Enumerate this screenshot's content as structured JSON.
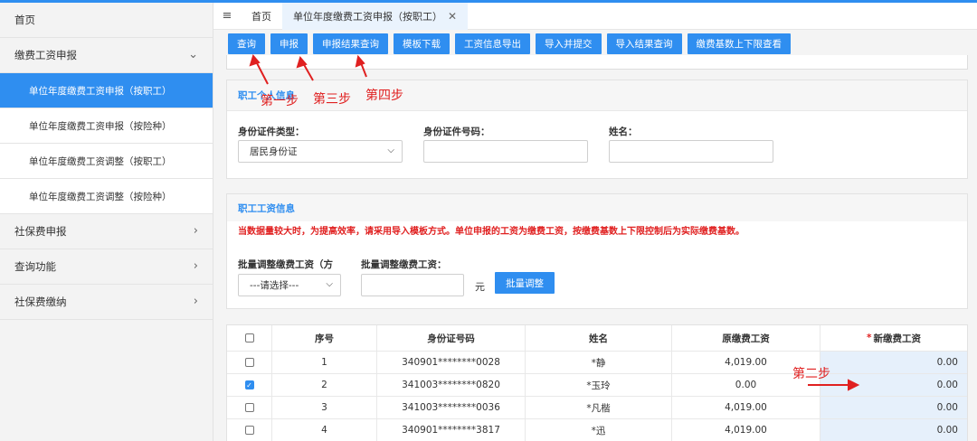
{
  "sidebar": {
    "home": "首页",
    "group1": "缴费工资申报",
    "sub_items": [
      "单位年度缴费工资申报（按职工）",
      "单位年度缴费工资申报（按险种）",
      "单位年度缴费工资调整（按职工）",
      "单位年度缴费工资调整（按险种）"
    ],
    "groups": [
      "社保费申报",
      "查询功能",
      "社保费缴纳"
    ]
  },
  "tabs": {
    "home": "首页",
    "active": "单位年度缴费工资申报（按职工）"
  },
  "toolbar": [
    "查询",
    "申报",
    "申报结果查询",
    "模板下载",
    "工资信息导出",
    "导入并提交",
    "导入结果查询",
    "缴费基数上下限查看"
  ],
  "personal": {
    "title": "职工个人信息",
    "id_type_label": "身份证件类型：",
    "id_type_value": "居民身份证",
    "id_no_label": "身份证件号码：",
    "name_label": "姓名："
  },
  "wage": {
    "title": "职工工资信息",
    "warning": "当数据量较大时，为提高效率，请采用导入模板方式。单位申报的工资为缴费工资，按缴费基数上下限控制后为实际缴费基数。",
    "batch_mode_label": "批量调整缴费工资（方",
    "batch_mode_value": "---请选择---",
    "batch_value_label": "批量调整缴费工资：",
    "unit": "元",
    "batch_button": "批量调整"
  },
  "table": {
    "headers": [
      "序号",
      "身份证号码",
      "姓名",
      "原缴费工资",
      "新缴费工资"
    ],
    "required_mark": "*",
    "rows": [
      {
        "no": "1",
        "id": "340901********0028",
        "name": "*静",
        "old": "4,019.00",
        "new": "0.00",
        "checked": false
      },
      {
        "no": "2",
        "id": "341003********0820",
        "name": "*玉玲",
        "old": "0.00",
        "new": "0.00",
        "checked": true
      },
      {
        "no": "3",
        "id": "341003********0036",
        "name": "*凡楷",
        "old": "4,019.00",
        "new": "0.00",
        "checked": false
      },
      {
        "no": "4",
        "id": "340901********3817",
        "name": "*迅",
        "old": "4,019.00",
        "new": "0.00",
        "checked": false
      }
    ]
  },
  "annotations": {
    "step1": "第一步",
    "step2": "第二步",
    "step3": "第三步",
    "step4": "第四步"
  },
  "colors": {
    "accent": "#2f8ef0",
    "annotation": "#e02020"
  },
  "icons": [
    "menu-icon",
    "close-icon",
    "chevron-down-icon",
    "chevron-right-icon",
    "select-arrow-icon",
    "checkbox-icon"
  ]
}
